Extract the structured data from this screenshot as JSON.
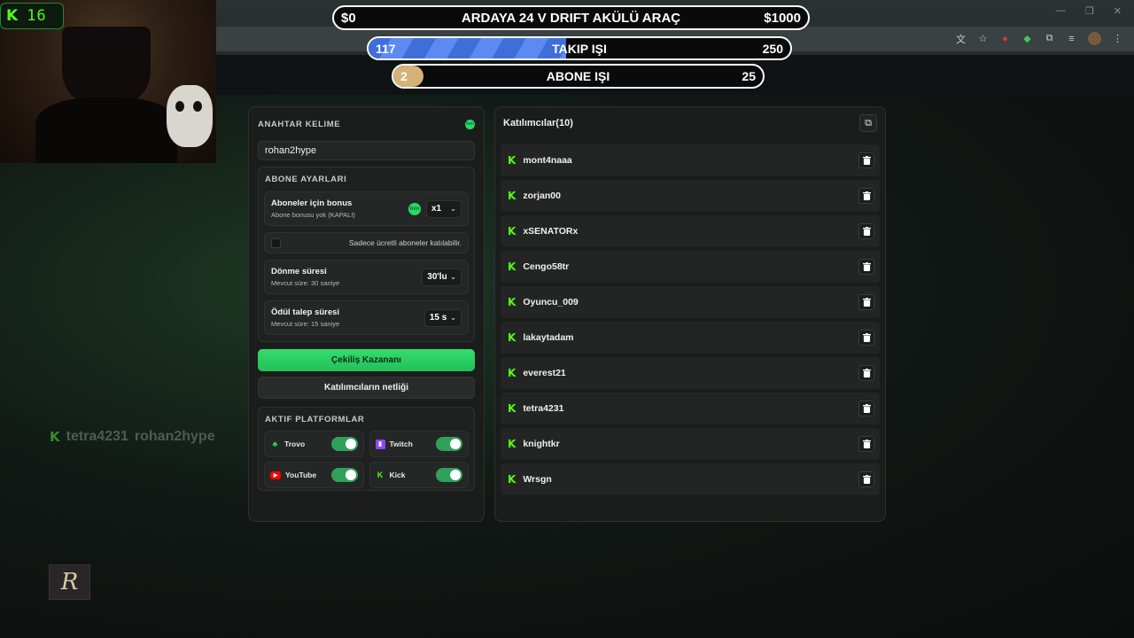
{
  "webcam": {
    "badge_icon": "kick-icon",
    "viewer_count": "16"
  },
  "goals": [
    {
      "left": "$0",
      "title": "ARDAYA 24 V DRIFT AKÜLÜ ARAÇ",
      "right": "$1000",
      "progress": 0.0
    },
    {
      "left": "117",
      "title": "TAKIP IŞI",
      "right": "250",
      "progress": 0.468
    },
    {
      "left": "2",
      "title": "ABONE IŞI",
      "right": "25",
      "progress": 0.08
    }
  ],
  "settings": {
    "keyword_title": "ANAHTAR KELIME",
    "keyword_badge": "ben",
    "keyword_value": "rohan2hype",
    "abone_title": "ABONE AYARLARI",
    "bonus_label": "Aboneler için bonus",
    "bonus_desc": "Abone bonusu yok (KAPALI)",
    "bonus_badge": "ben",
    "bonus_multiplier": "x1",
    "paid_only_label": "Sadece ücretli aboneler katılabilir.",
    "spin_label": "Dönme süresi",
    "spin_desc": "Mevcut süre: 30 saniye",
    "spin_value": "30'lu",
    "claim_label": "Ödül talep süresi",
    "claim_desc": "Mevcut süre: 15 saniye",
    "claim_value": "15 s",
    "winner_button": "Çekiliş Kazananı",
    "clear_button": "Katılımcıların netliği",
    "platforms_title": "AKTIF PLATFORMLAR",
    "platforms": [
      {
        "name": "Trovo",
        "icon": "trovo-icon",
        "enabled": true
      },
      {
        "name": "Twitch",
        "icon": "twitch-icon",
        "enabled": true
      },
      {
        "name": "YouTube",
        "icon": "youtube-icon",
        "enabled": true
      },
      {
        "name": "Kick",
        "icon": "kick-icon",
        "enabled": true
      }
    ]
  },
  "participants": {
    "title": "Katılımcılar(10)",
    "items": [
      "mont4naaa",
      "zorjan00",
      "xSENATORx",
      "Cengo58tr",
      "Oyuncu_009",
      "lakaytadam",
      "everest21",
      "tetra4231",
      "knightkr",
      "Wrsgn"
    ]
  },
  "overlay": {
    "name1": "tetra4231",
    "name2": "rohan2hype",
    "logo_text": "R"
  },
  "colors": {
    "accent_green": "#2bd865",
    "kick_green": "#53fc18",
    "follow_bar": "#3e6fd8",
    "sub_bar": "#d4b27a"
  }
}
